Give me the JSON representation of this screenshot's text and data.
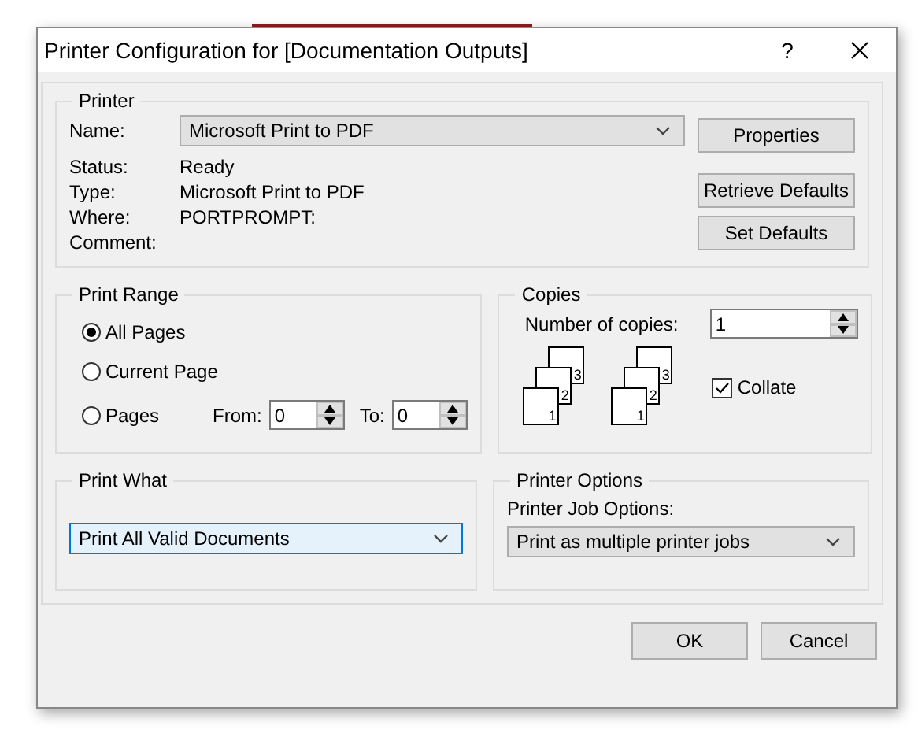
{
  "window": {
    "title": "Printer Configuration for [Documentation Outputs]",
    "help": "?"
  },
  "printer": {
    "legend": "Printer",
    "name_label": "Name:",
    "name_value": "Microsoft Print to PDF",
    "details": [
      {
        "label": "Status:",
        "value": "Ready"
      },
      {
        "label": "Type:",
        "value": "Microsoft Print to PDF"
      },
      {
        "label": "Where:",
        "value": "PORTPROMPT:"
      },
      {
        "label": "Comment:"
      }
    ],
    "buttons": [
      "Properties",
      "Retrieve Defaults",
      "Set Defaults"
    ]
  },
  "print_range": {
    "legend": "Print Range",
    "options": [
      {
        "label": "All Pages",
        "selected": true
      },
      {
        "label": "Current Page",
        "selected": false
      },
      {
        "label": "Pages",
        "selected": false
      }
    ],
    "from_label": "From:",
    "from_value": "0",
    "to_label": "To:",
    "to_value": "0"
  },
  "copies": {
    "legend": "Copies",
    "label": "Number of copies:",
    "value": "1",
    "stacks": [
      [
        "3",
        "2",
        "1"
      ],
      [
        "3",
        "2",
        "1"
      ]
    ],
    "collate": {
      "label": "Collate",
      "checked": true
    }
  },
  "print_what": {
    "legend": "Print What",
    "value": "Print All Valid Documents"
  },
  "printer_options": {
    "legend": "Printer Options",
    "label": "Printer Job Options:",
    "value": "Print as multiple printer jobs"
  },
  "buttons": [
    "OK",
    "Cancel"
  ]
}
